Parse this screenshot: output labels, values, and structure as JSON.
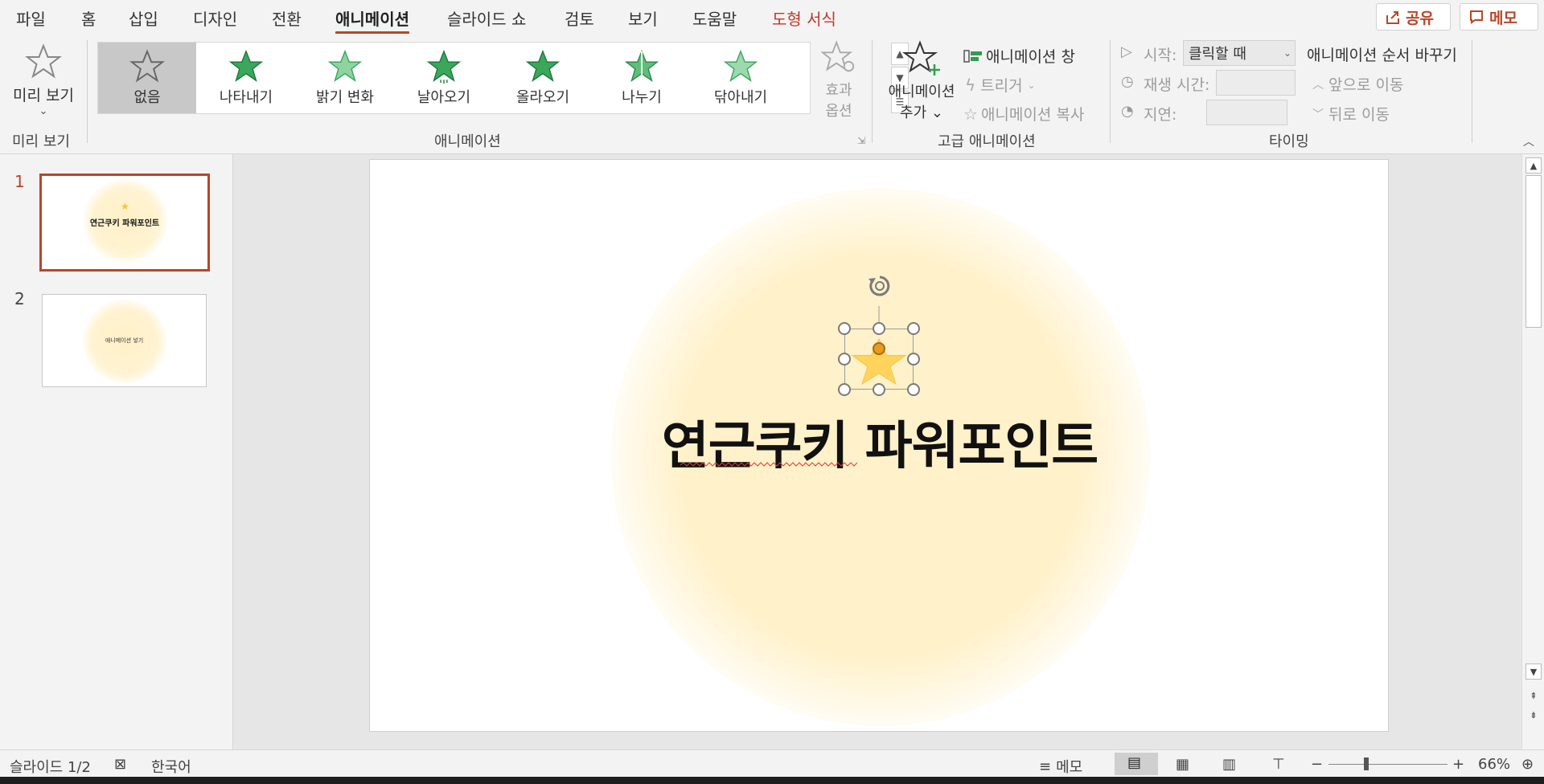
{
  "tabs": [
    {
      "label": "파일"
    },
    {
      "label": "홈"
    },
    {
      "label": "삽입"
    },
    {
      "label": "디자인"
    },
    {
      "label": "전환"
    },
    {
      "label": "애니메이션"
    },
    {
      "label": "슬라이드 쇼"
    },
    {
      "label": "검토"
    },
    {
      "label": "보기"
    },
    {
      "label": "도움말"
    },
    {
      "label": "도형 서식"
    }
  ],
  "active_tab": "애니메이션",
  "share_label": "공유",
  "memo_label": "메모",
  "ribbon": {
    "preview": {
      "button_label": "미리 보기",
      "group_label": "미리 보기"
    },
    "animation": {
      "group_label": "애니메이션",
      "gallery": [
        {
          "label": "없음",
          "selected": true
        },
        {
          "label": "나타내기"
        },
        {
          "label": "밝기 변화"
        },
        {
          "label": "날아오기"
        },
        {
          "label": "올라오기"
        },
        {
          "label": "나누기"
        },
        {
          "label": "닦아내기"
        }
      ],
      "effect_options_line1": "효과",
      "effect_options_line2": "옵션"
    },
    "advanced": {
      "group_label": "고급 애니메이션",
      "add_line1": "애니메이션",
      "add_line2": "추가",
      "pane": "애니메이션 창",
      "trigger": "트리거",
      "painter": "애니메이션 복사"
    },
    "timing": {
      "group_label": "타이밍",
      "start_label": "시작:",
      "start_value": "클릭할 때",
      "duration_label": "재생 시간:",
      "delay_label": "지연:",
      "reorder_title": "애니메이션 순서 바꾸기",
      "move_earlier": "앞으로 이동",
      "move_later": "뒤로 이동"
    }
  },
  "slides": [
    {
      "number": "1",
      "text": "연근쿠키 파워포인트",
      "selected": true
    },
    {
      "number": "2",
      "text": "애니메이션 넣기"
    }
  ],
  "slide_title": "연근쿠키 파워포인트",
  "status": {
    "slide_info": "슬라이드 1/2",
    "language": "한국어",
    "notes": "메모",
    "zoom": "66%"
  },
  "colors": {
    "accent": "#b7472a",
    "star": "#ffd35c",
    "glow": "#fff1c9",
    "gallery_star": "#2e9e4f"
  }
}
